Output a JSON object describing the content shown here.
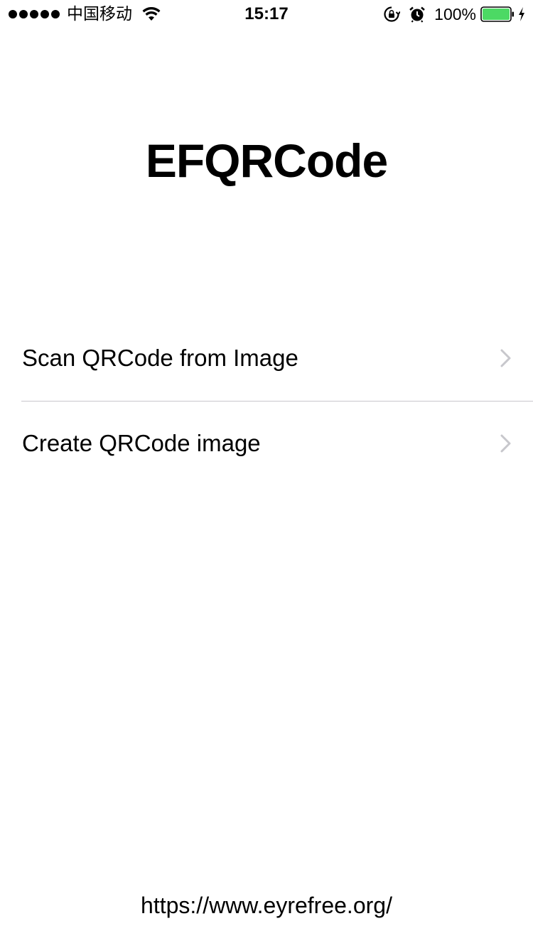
{
  "status_bar": {
    "carrier": "中国移动",
    "time": "15:17",
    "battery_percent": "100%",
    "battery_level": 1.0,
    "signal_bars": 5,
    "icons": [
      "wifi-icon",
      "lock-rotation-icon",
      "alarm-icon",
      "battery-icon",
      "charging-icon"
    ]
  },
  "header": {
    "title": "EFQRCode"
  },
  "menu": {
    "items": [
      {
        "label": "Scan QRCode from Image",
        "icon": "chevron-right-icon"
      },
      {
        "label": "Create QRCode image",
        "icon": "chevron-right-icon"
      }
    ]
  },
  "footer": {
    "link_text": "https://www.eyrefree.org/"
  },
  "colors": {
    "background": "#ffffff",
    "text": "#000000",
    "chevron": "#c7c7cc",
    "separator": "#c8c7cc",
    "battery_fill": "#4cd964"
  }
}
